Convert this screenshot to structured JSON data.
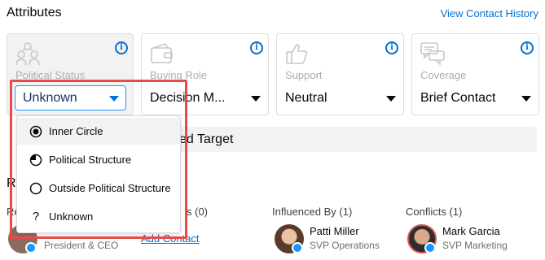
{
  "header": {
    "title": "Attributes",
    "link": "View Contact History"
  },
  "cards": [
    {
      "label": "Political Status",
      "value": "Unknown",
      "icon": "group-icon"
    },
    {
      "label": "Buying Role",
      "value": "Decision M...",
      "icon": "wallet-icon"
    },
    {
      "label": "Support",
      "value": "Neutral",
      "icon": "thumbs-up-icon"
    },
    {
      "label": "Coverage",
      "value": "Brief Contact",
      "icon": "chat-icon"
    }
  ],
  "info_glyph": "i",
  "bar": {
    "text": "ed Target"
  },
  "section": {
    "title_partial": "R",
    "col1_partial": "Re",
    "col2_partial": "s (0)"
  },
  "dropdown": {
    "options": [
      {
        "label": "Inner Circle",
        "icon": "radio-selected-icon"
      },
      {
        "label": "Political Structure",
        "icon": "half-circle-icon"
      },
      {
        "label": "Outside Political Structure",
        "icon": "radio-empty-icon"
      },
      {
        "label": "Unknown",
        "icon": "question-icon"
      }
    ],
    "question_glyph": "?"
  },
  "people": {
    "col1": {
      "title": "President & CEO"
    },
    "col2": {
      "add_label": "Add Contact"
    },
    "influenced": {
      "heading": "Influenced By (1)",
      "name": "Patti Miller",
      "title": "SVP Operations"
    },
    "conflicts": {
      "heading": "Conflicts (1)",
      "name": "Mark Garcia",
      "title": "SVP Marketing"
    }
  },
  "colors": {
    "accent": "#0070d2",
    "highlight_frame": "#e84a4a"
  }
}
